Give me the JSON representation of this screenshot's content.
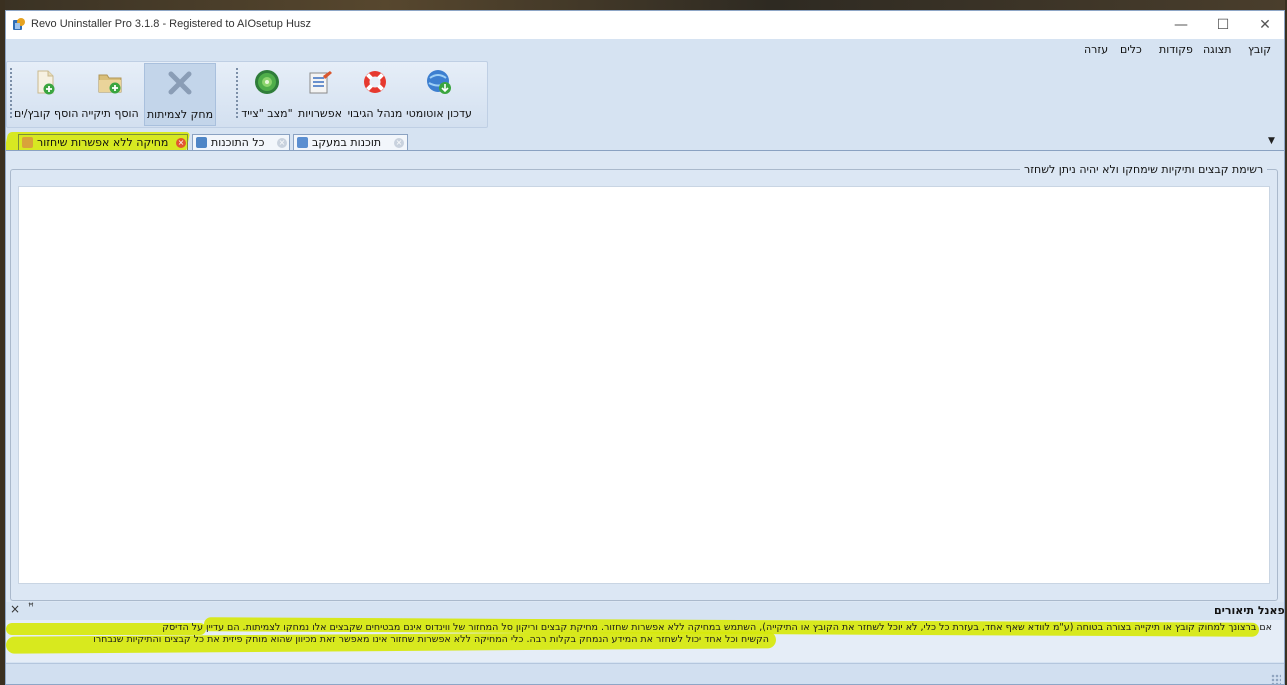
{
  "window": {
    "title": "Revo Uninstaller Pro 3.1.8 - Registered to AIOsetup Husz",
    "controls": {
      "minimize": "—",
      "maximize": "☐",
      "close": "✕"
    }
  },
  "menu": {
    "file": "קובץ",
    "view": "תצוגה",
    "commands": "פקודות",
    "tools": "כלים",
    "help": "עזרה"
  },
  "toolbar": {
    "add_files": "הוסף קובץ/ים",
    "add_folder": "הוסף תיקייה",
    "delete_permanent": "מחק לצמיתות",
    "hunter_mode": "מצב \"צייד\"",
    "options": "אפשרויות",
    "backup_manager": "מנהל הגיבוי",
    "auto_update": "עדכון אוטומטי"
  },
  "tabs": {
    "unrecoverable_delete": "מחיקה ללא אפשרות שיחזור",
    "all_programs": "כל התוכנות",
    "traced_programs": "תוכנות במעקב"
  },
  "main": {
    "group_title": "רשימת קבצים ותיקיות שימחקו ולא יהיה ניתן לשחזר"
  },
  "description_panel": {
    "title": "פאנל תיאורים",
    "close": "×",
    "pin": "ꟸ",
    "line1": "אם ברצונך למחוק קובץ או תיקייה בצורה בטוחה (ע\"מ לוודא שאף אחד, בעזרת כל כלי, לא יוכל לשחזר את הקובץ או התיקייה), השתמש במחיקה ללא אפשרות שחזור. מחיקת קבצים וריקון סל המחזור של ווינדוס אינם מבטיחים שקבצים אלו נמחקו לצמיתות. הם עדיין על הדיסק",
    "line2": "הקשיח וכל אחד יכול לשחזר את המידע הנמחק בקלות רבה. כלי המחיקה ללא אפשרות שחזור אינו מאפשר זאת מכיוון שהוא מוחק פיזית את כל קבצים והתיקיות שנבחרו"
  },
  "colors": {
    "highlight": "#d7e80b",
    "window_bg": "#d6e3f2",
    "list_bg": "#ffffff"
  }
}
